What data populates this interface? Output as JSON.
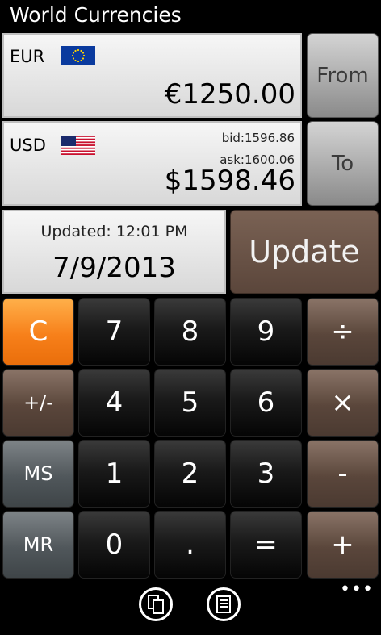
{
  "app": {
    "title": "World Currencies"
  },
  "from_panel": {
    "currency_code": "EUR",
    "flag_icon": "eu-flag-icon",
    "amount": "€1250.00",
    "button_label": "From"
  },
  "to_panel": {
    "currency_code": "USD",
    "flag_icon": "us-flag-icon",
    "bid": "bid:1596.86",
    "ask": "ask:1600.06",
    "amount": "$1598.46",
    "button_label": "To"
  },
  "updated": {
    "label": "Updated: 12:01 PM",
    "date": "7/9/2013",
    "button_label": "Update"
  },
  "keypad": {
    "c": "C",
    "seven": "7",
    "eight": "8",
    "nine": "9",
    "divide": "÷",
    "plusminus": "+/-",
    "four": "4",
    "five": "5",
    "six": "6",
    "multiply": "×",
    "ms": "MS",
    "one": "1",
    "two": "2",
    "three": "3",
    "minus": "-",
    "mr": "MR",
    "zero": "0",
    "dot": ".",
    "equals": "=",
    "plus": "+"
  },
  "appbar": {
    "copy_icon": "copy-icon",
    "paste_icon": "document-icon",
    "more_label": "•••"
  },
  "colors": {
    "orange_key": "#f7801a",
    "brown_key": "#5a463b",
    "gray_key": "#50575b",
    "dark_key": "#1a1a1a"
  }
}
